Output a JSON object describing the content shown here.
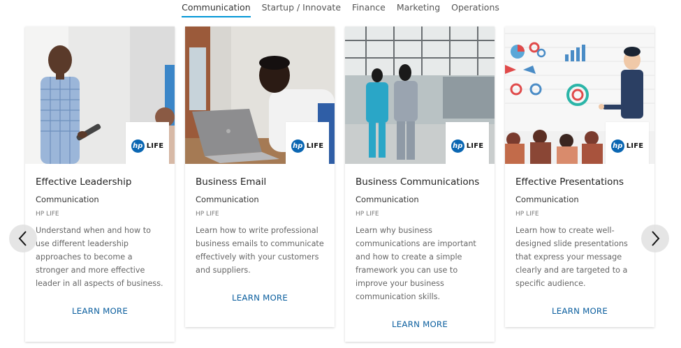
{
  "tabs": [
    {
      "label": "Communication",
      "active": true
    },
    {
      "label": "Startup / Innovate",
      "active": false
    },
    {
      "label": "Finance",
      "active": false
    },
    {
      "label": "Marketing",
      "active": false
    },
    {
      "label": "Operations",
      "active": false
    }
  ],
  "logo": {
    "mark": "hp",
    "text": "LIFE"
  },
  "cards": [
    {
      "title": "Effective Leadership",
      "category": "Communication",
      "provider": "HP LIFE",
      "description": "Understand when and how to use different leadership approaches to become a stronger and more effective leader in all aspects of business.",
      "cta": "LEARN MORE"
    },
    {
      "title": "Business Email",
      "category": "Communication",
      "provider": "HP LIFE",
      "description": "Learn how to write professional business emails to communicate effectively with your customers and suppliers.",
      "cta": "LEARN MORE"
    },
    {
      "title": "Business Communications",
      "category": "Communication",
      "provider": "HP LIFE",
      "description": "Learn why business communications are important and how to create a simple framework you can use to improve your business communication skills.",
      "cta": "LEARN MORE"
    },
    {
      "title": "Effective Presentations",
      "category": "Communication",
      "provider": "HP LIFE",
      "description": "Learn how to create well-designed slide presentations that express your message clearly and are targeted to a specific audience.",
      "cta": "LEARN MORE"
    }
  ],
  "carousel": {
    "prev_icon": "chevron-left-icon",
    "next_icon": "chevron-right-icon"
  },
  "colors": {
    "accent": "#0096d6",
    "link": "#0a5e9e",
    "hp_blue": "#0a66b2"
  }
}
